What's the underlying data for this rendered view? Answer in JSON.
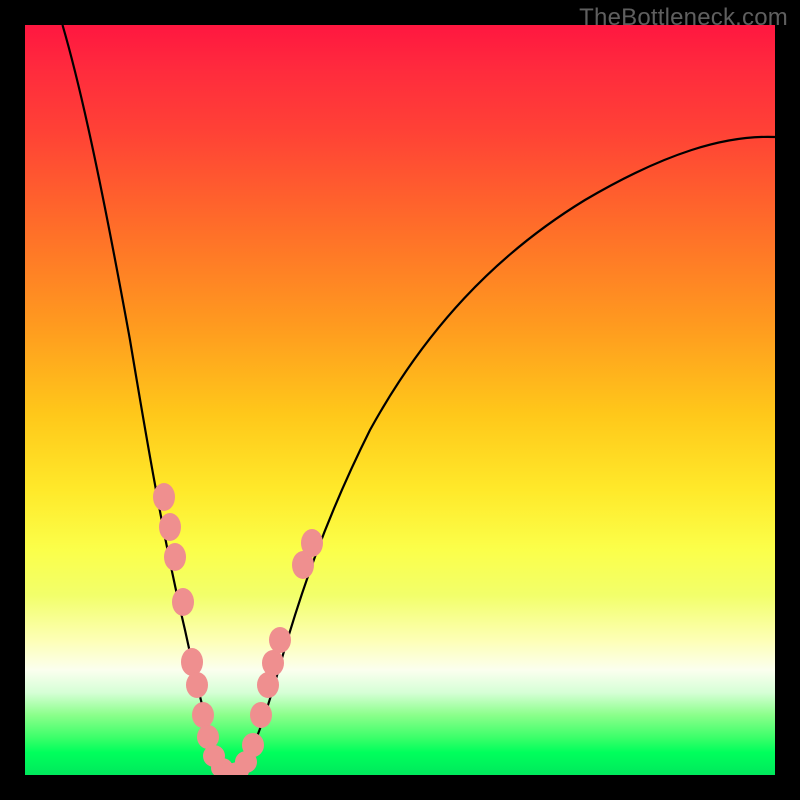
{
  "watermark": "TheBottleneck.com",
  "chart_data": {
    "type": "line",
    "title": "",
    "xlabel": "",
    "ylabel": "",
    "xlim": [
      0,
      100
    ],
    "ylim": [
      0,
      100
    ],
    "notes": "Bottleneck-percentage style V-curve over rainbow heatmap. No axis ticks or labels are visible. Values approximate curve height (bottleneck %) across horizontal position.",
    "series": [
      {
        "name": "left-curve",
        "x": [
          5,
          8,
          11,
          14,
          17,
          19,
          21,
          23,
          24.5,
          26
        ],
        "values": [
          100,
          87,
          73,
          58,
          44,
          33,
          23,
          13,
          6,
          0
        ]
      },
      {
        "name": "right-curve",
        "x": [
          29,
          31,
          33,
          36,
          40,
          46,
          54,
          64,
          78,
          95,
          100
        ],
        "values": [
          0,
          6,
          13,
          23,
          34,
          46,
          57,
          67,
          76,
          83,
          85
        ]
      }
    ],
    "markers": {
      "name": "highlight-points",
      "color": "#f08080",
      "points": [
        {
          "x": 18.5,
          "y": 37
        },
        {
          "x": 19.3,
          "y": 33
        },
        {
          "x": 20.0,
          "y": 29
        },
        {
          "x": 21.0,
          "y": 23
        },
        {
          "x": 22.3,
          "y": 15
        },
        {
          "x": 22.9,
          "y": 12
        },
        {
          "x": 23.7,
          "y": 8
        },
        {
          "x": 24.4,
          "y": 5
        },
        {
          "x": 25.2,
          "y": 2.5
        },
        {
          "x": 26.2,
          "y": 1
        },
        {
          "x": 27.3,
          "y": 0.4
        },
        {
          "x": 28.4,
          "y": 0.6
        },
        {
          "x": 29.5,
          "y": 1.8
        },
        {
          "x": 30.4,
          "y": 4
        },
        {
          "x": 31.5,
          "y": 8
        },
        {
          "x": 32.4,
          "y": 12
        },
        {
          "x": 33.1,
          "y": 15
        },
        {
          "x": 34.0,
          "y": 18
        },
        {
          "x": 37.0,
          "y": 28
        },
        {
          "x": 38.2,
          "y": 31
        }
      ]
    },
    "gradient_stops": [
      {
        "pct": 0,
        "color": "#ff1740"
      },
      {
        "pct": 14,
        "color": "#ff4136"
      },
      {
        "pct": 40,
        "color": "#ff9a1f"
      },
      {
        "pct": 62,
        "color": "#ffe92a"
      },
      {
        "pct": 86,
        "color": "#fbffef"
      },
      {
        "pct": 100,
        "color": "#00e85c"
      }
    ]
  }
}
